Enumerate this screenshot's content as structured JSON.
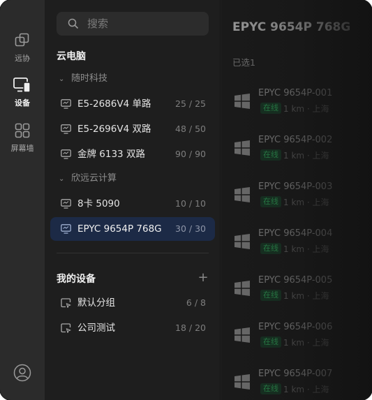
{
  "rail": {
    "items": [
      {
        "label": "远协",
        "icon": "remote-assist-icon"
      },
      {
        "label": "设备",
        "icon": "devices-icon",
        "active": true
      },
      {
        "label": "屏幕墙",
        "icon": "screen-wall-icon"
      }
    ],
    "avatar_icon": "user-avatar-icon"
  },
  "sidebar": {
    "search_placeholder": "搜索",
    "cloud_section": "云电脑",
    "groups": [
      {
        "name": "随时科技",
        "rows": [
          {
            "name": "E5-2686V4 单路",
            "count": "25 / 25"
          },
          {
            "name": "E5-2696V4 双路",
            "count": "48 / 50"
          },
          {
            "name": "金牌 6133 双路",
            "count": "90 / 90"
          }
        ]
      },
      {
        "name": "欣远云计算",
        "rows": [
          {
            "name": "8卡 5090",
            "count": "10 / 10"
          },
          {
            "name": "EPYC 9654P 768G",
            "count": "30 / 30",
            "selected": true
          }
        ]
      }
    ],
    "my_devices_section": "我的设备",
    "my_devices": [
      {
        "name": "默认分组",
        "count": "6 / 8"
      },
      {
        "name": "公司测试",
        "count": "18 / 20"
      }
    ]
  },
  "main": {
    "title": "EPYC 9654P 768G",
    "selected_count": "已选1",
    "devices": [
      {
        "name": "EPYC 9654P-001",
        "status": "在线",
        "meta": "1 km · 上海"
      },
      {
        "name": "EPYC 9654P-002",
        "status": "在线",
        "meta": "1 km · 上海"
      },
      {
        "name": "EPYC 9654P-003",
        "status": "在线",
        "meta": "1 km · 上海"
      },
      {
        "name": "EPYC 9654P-004",
        "status": "在线",
        "meta": "1 km · 上海"
      },
      {
        "name": "EPYC 9654P-005",
        "status": "在线",
        "meta": "1 km · 上海"
      },
      {
        "name": "EPYC 9654P-006",
        "status": "在线",
        "meta": "1 km · 上海"
      },
      {
        "name": "EPYC 9654P-007",
        "status": "在线",
        "meta": "1 km · 上海"
      }
    ]
  },
  "colors": {
    "accent_selected": "#1c2a46",
    "online_green": "#2a8a4c"
  }
}
